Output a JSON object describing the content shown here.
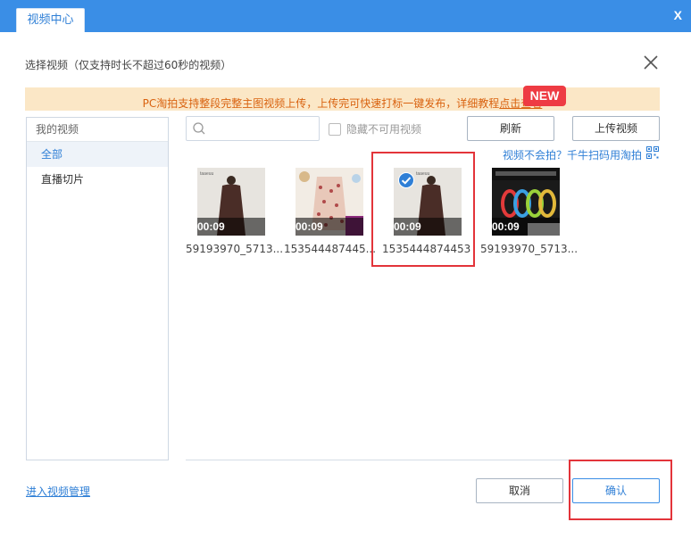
{
  "window": {
    "tab_title": "视频中心",
    "close_glyph": "X"
  },
  "dialog": {
    "subtitle": "选择视频（仅支持时长不超过60秒的视频）"
  },
  "notice": {
    "text": "PC淘拍支持整段完整主图视频上传，上传完可快速打标一键发布，详细教程",
    "link": "点击查看",
    "badge": "NEW"
  },
  "sidebar": {
    "header": "我的视频",
    "items": [
      {
        "label": "全部",
        "active": true
      },
      {
        "label": "直播切片",
        "active": false
      }
    ]
  },
  "toolbar": {
    "search_value": "",
    "search_placeholder": "",
    "hide_unavailable": "隐藏不可用视频",
    "refresh": "刷新",
    "upload": "上传视频"
  },
  "scan_link": "视频不会拍？千牛扫码用淘拍",
  "videos": [
    {
      "duration": "00:09",
      "name": "59193970_5713...",
      "selected": false
    },
    {
      "duration": "00:09",
      "name": "153544487445...",
      "selected": false
    },
    {
      "duration": "00:09",
      "name": "1535444874453",
      "selected": true
    },
    {
      "duration": "00:09",
      "name": "59193970_5713...",
      "selected": false
    }
  ],
  "footer": {
    "manage_link": "进入视频管理",
    "cancel": "取消",
    "confirm": "确认"
  },
  "colors": {
    "accent": "#3a8ee6",
    "highlight_frame": "#e3343a",
    "notice_bg": "#fbe7c6",
    "notice_text": "#d9620f"
  }
}
